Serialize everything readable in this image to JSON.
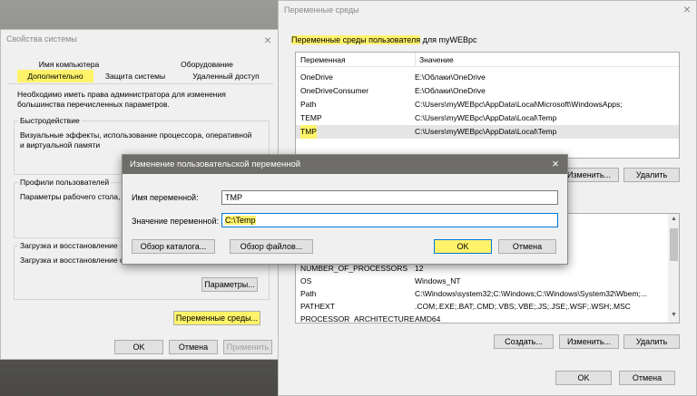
{
  "system_props": {
    "title": "Свойства системы",
    "tabs_row1": [
      "Имя компьютера",
      "Оборудование"
    ],
    "tabs_row2": [
      "Дополнительно",
      "Защита системы",
      "Удаленный доступ"
    ],
    "admin_note": "Необходимо иметь права администратора для изменения большинства перечисленных параметров.",
    "perf": {
      "label": "Быстродействие",
      "text": "Визуальные эффекты, использование процессора, оперативной и виртуальной памяти"
    },
    "profiles": {
      "label": "Профили пользователей",
      "text": "Параметры рабочего стола, с"
    },
    "startup": {
      "label": "Загрузка и восстановление",
      "text": "Загрузка и восстановление с",
      "params_button": "Параметры..."
    },
    "env_button": "Переменные среды...",
    "ok": "OK",
    "cancel": "Отмена",
    "apply": "Применить"
  },
  "env_window": {
    "title": "Переменные среды",
    "user_section_label_highlight": "Переменные среды пользователя",
    "user_section_label_rest": " для myWEBpc",
    "col_variable": "Переменная",
    "col_value": "Значение",
    "user_vars": [
      {
        "name": "OneDrive",
        "value": "E:\\Облаки\\OneDrive"
      },
      {
        "name": "OneDriveConsumer",
        "value": "E:\\Облаки\\OneDrive"
      },
      {
        "name": "Path",
        "value": "C:\\Users\\myWEBpc\\AppData\\Local\\Microsoft\\WindowsApps;"
      },
      {
        "name": "TEMP",
        "value": "C:\\Users\\myWEBpc\\AppData\\Local\\Temp"
      },
      {
        "name": "TMP",
        "value": "C:\\Users\\myWEBpc\\AppData\\Local\\Temp"
      }
    ],
    "user_buttons": {
      "edit": "Изменить...",
      "delete": "Удалить"
    },
    "sys_vars": [
      {
        "name": "NUMBER_OF_PROCESSORS",
        "value": "12"
      },
      {
        "name": "OS",
        "value": "Windows_NT"
      },
      {
        "name": "Path",
        "value": "C:\\Windows\\system32;C:\\Windows;C:\\Windows\\System32\\Wbem;..."
      },
      {
        "name": "PATHEXT",
        "value": ".COM;.EXE;.BAT;.CMD;.VBS;.VBE;.JS;.JSE;.WSF;.WSH;.MSC"
      },
      {
        "name": "PROCESSOR_ARCHITECTURE",
        "value": "AMD64"
      }
    ],
    "sys_buttons": {
      "create": "Создать...",
      "edit": "Изменить...",
      "delete": "Удалить"
    },
    "ok": "OK",
    "cancel": "Отмена"
  },
  "edit_dialog": {
    "title": "Изменение пользовательской переменной",
    "name_label": "Имя переменной:",
    "name_value": "TMP",
    "value_label": "Значение переменной:",
    "value_value": "C:\\Temp",
    "browse_dir": "Обзор каталога...",
    "browse_file": "Обзор файлов...",
    "ok": "OK",
    "cancel": "Отмена"
  },
  "colors": {
    "highlight": "#fff36a",
    "dialog_title_bg": "#6e6d6a",
    "focus_border": "#0078d7"
  }
}
